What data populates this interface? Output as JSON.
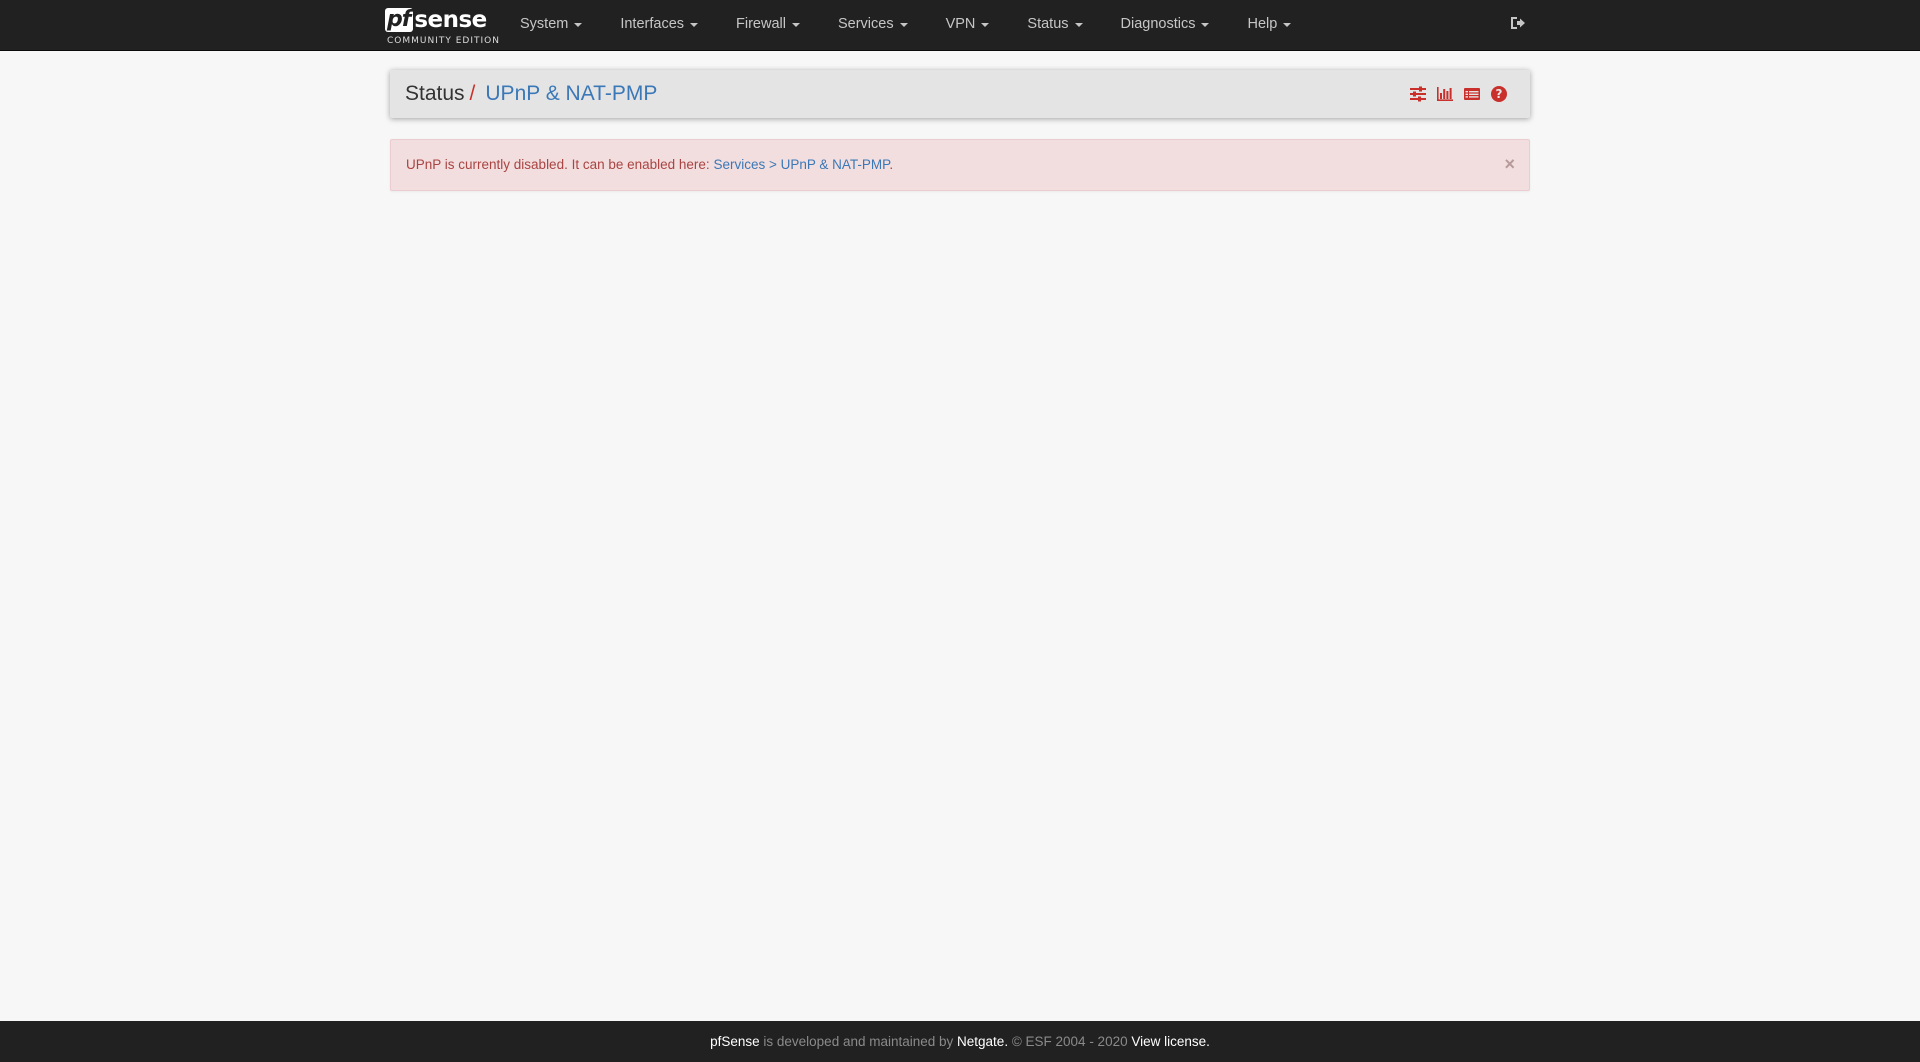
{
  "navbar": {
    "brand": {
      "logo_pf": "pf",
      "logo_sense": "sense",
      "edition": "COMMUNITY EDITION"
    },
    "menu": [
      {
        "label": "System"
      },
      {
        "label": "Interfaces"
      },
      {
        "label": "Firewall"
      },
      {
        "label": "Services"
      },
      {
        "label": "VPN"
      },
      {
        "label": "Status"
      },
      {
        "label": "Diagnostics"
      },
      {
        "label": "Help"
      }
    ],
    "logout_icon": "sign-out-icon"
  },
  "header": {
    "breadcrumb_root": "Status",
    "breadcrumb_sep": "/",
    "breadcrumb_current": "UPnP & NAT-PMP",
    "icons": [
      "sliders-icon",
      "bar-chart-icon",
      "log-table-icon",
      "help-circle-icon"
    ]
  },
  "alert": {
    "text": "UPnP is currently disabled. It can be enabled here: ",
    "link": "Services > UPnP & NAT-PMP",
    "after_link": ".",
    "close": "×"
  },
  "footer": {
    "product": "pfSense",
    "middle": " is developed and maintained by ",
    "company": "Netgate.",
    "copyright": " © ESF 2004 - 2020 ",
    "license": "View license."
  },
  "colors": {
    "navbar_bg": "#212121",
    "page_bg": "#f7f7f7",
    "accent_red": "#c9302c",
    "link_blue": "#3b78b7",
    "alert_bg": "#f2dede",
    "alert_text": "#a94442"
  }
}
